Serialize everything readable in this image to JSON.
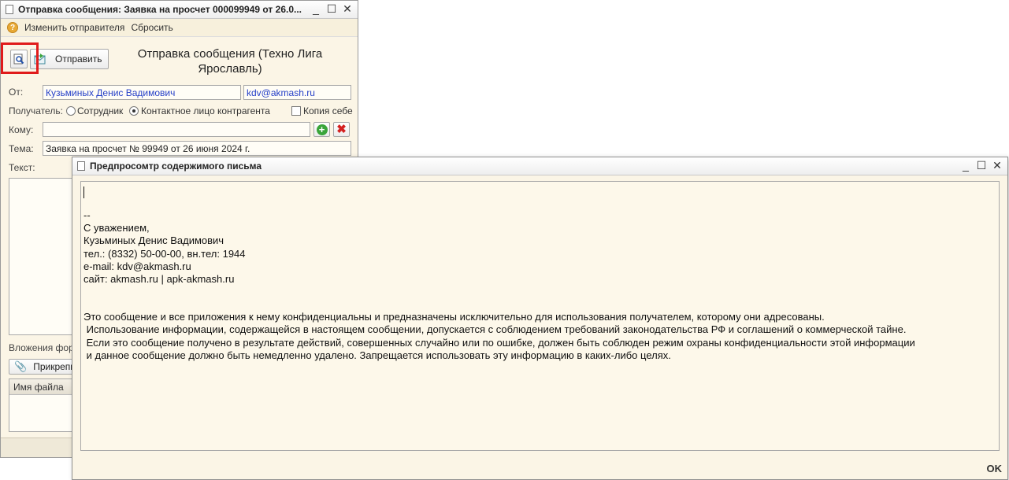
{
  "window1": {
    "title": "Отправка сообщения: Заявка на просчет 000099949 от 26.0...",
    "controls": {
      "minimize": "_",
      "maximize": "☐",
      "close": "✕"
    },
    "cmd": {
      "change_sender": "Изменить отправителя",
      "reset": "Сбросить"
    },
    "send_button": "Отправить",
    "form_title": "Отправка сообщения (Техно Лига Ярославль)",
    "from_label": "От:",
    "from_name": "Кузьминых Денис Вадимович",
    "from_email": "kdv@akmash.ru",
    "recipient_label": "Получатель:",
    "radio_employee": "Сотрудник",
    "radio_contact": "Контактное лицо контрагента",
    "copy_self": "Копия себе",
    "to_label": "Кому:",
    "to_value": "",
    "subject_label": "Тема:",
    "subject_value": "Заявка на просчет № 99949 от 26 июня 2024 г.",
    "text_label": "Текст:",
    "attachments_label": "Вложения форм",
    "attach_button": "Прикрепит",
    "table_header": "Имя файла"
  },
  "window2": {
    "title": "Предпросомтр содержимого письма",
    "controls": {
      "minimize": "_",
      "maximize": "☐",
      "close": "✕"
    },
    "body_lines": [
      "--",
      "С уважением,",
      "Кузьминых Денис Вадимович",
      "тел.: (8332) 50-00-00, вн.тел: 1944",
      "e-mail: kdv@akmash.ru",
      "сайт: akmash.ru | apk-akmash.ru",
      "",
      "",
      "Это сообщение и все приложения к нему конфиденциальны и предназначены исключительно для использования получателем, которому они адресованы.",
      " Использование информации, содержащейся в настоящем сообщении, допускается с соблюдением требований законодательства РФ и соглашений о коммерческой тайне.",
      " Если это сообщение получено в результате действий, совершенных случайно или по ошибке, должен быть соблюден режим охраны конфиденциальности этой информации",
      " и данное сообщение должно быть немедленно удалено. Запрещается использовать эту информацию в каких-либо целях."
    ],
    "ok": "OK"
  }
}
